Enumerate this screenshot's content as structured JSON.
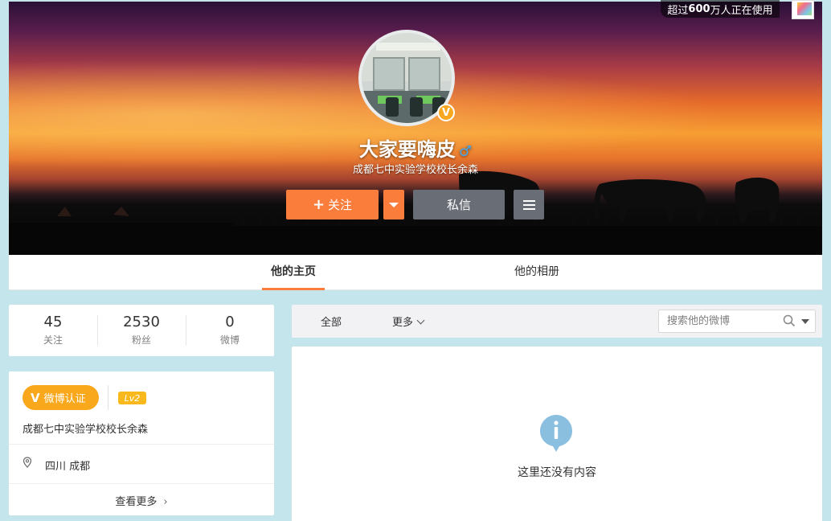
{
  "topbar": {
    "users_prefix": "超过",
    "users_count": "600",
    "users_suffix": "万人正在使用"
  },
  "profile": {
    "nickname": "大家要嗨皮",
    "gender_symbol": "♂",
    "verify_badge": "V",
    "intro": "成都七中实验学校校长余森"
  },
  "actions": {
    "follow_plus": "+",
    "follow_label": "关注",
    "message_label": "私信"
  },
  "tabs": [
    {
      "label": "他的主页",
      "active": true
    },
    {
      "label": "他的相册",
      "active": false
    }
  ],
  "stats": [
    {
      "value": "45",
      "label": "关注"
    },
    {
      "value": "2530",
      "label": "粉丝"
    },
    {
      "value": "0",
      "label": "微博"
    }
  ],
  "info": {
    "verify_mark": "V",
    "verify_label": "微博认证",
    "level": "Lv2",
    "description": "成都七中实验学校校长余森",
    "location": "四川 成都",
    "more_label": "查看更多",
    "more_arrow": "›"
  },
  "feed": {
    "filter_all": "全部",
    "filter_more": "更多",
    "search_placeholder": "搜索他的微博",
    "empty_text": "这里还没有内容"
  },
  "colors": {
    "accent": "#fa7d3c",
    "button_dark": "#686d76",
    "verify_gold": "#f9a71b",
    "page_bg": "#c5e5ec",
    "info_icon_blue": "#8bbfe0"
  },
  "icons": {
    "verify": "v-badge-icon",
    "gender": "male-icon",
    "menu": "hamburger-menu-icon",
    "location": "location-pin-icon",
    "search": "search-icon",
    "empty": "info-icon"
  }
}
